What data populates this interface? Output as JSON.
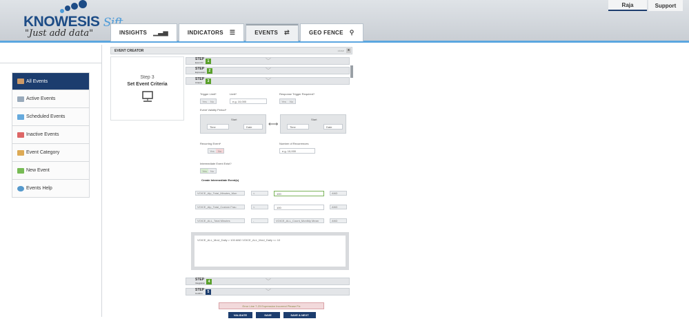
{
  "brand": {
    "name": "KNOWESIS",
    "sub": "Sift",
    "tagline": "\"Just add data\""
  },
  "topnav": {
    "user": "Raja",
    "support": "Support"
  },
  "tabs": [
    {
      "label": "INSIGHTS",
      "icon": "bar-chart-icon"
    },
    {
      "label": "INDICATORS",
      "icon": "list-icon"
    },
    {
      "label": "EVENTS",
      "icon": "repeat-icon"
    },
    {
      "label": "GEO FENCE",
      "icon": "map-pin-icon"
    }
  ],
  "sidebar": {
    "items": [
      {
        "label": "All Events"
      },
      {
        "label": "Active Events"
      },
      {
        "label": "Scheduled Events"
      },
      {
        "label": "Inactive Events"
      },
      {
        "label": "Event Category"
      },
      {
        "label": "New Event"
      },
      {
        "label": "Events Help"
      }
    ]
  },
  "panel": {
    "title": "EVENT CREATOR",
    "close": "close",
    "x": "x"
  },
  "stepcard": {
    "line1": "Step 3",
    "line2": "Set Event Criteria"
  },
  "steps": [
    {
      "label": "STEP",
      "sub": "Event ID",
      "num": "1",
      "color": "#5aa02c"
    },
    {
      "label": "STEP",
      "sub": "Expression",
      "num": "2",
      "color": "#5aa02c"
    },
    {
      "label": "STEP",
      "sub": "Criteria",
      "num": "3",
      "color": "#5aa02c"
    },
    {
      "label": "STEP",
      "sub": "Integration",
      "num": "4",
      "color": "#5aa02c"
    },
    {
      "label": "STEP",
      "sub": "Confirm",
      "num": "5",
      "color": "#1c3d6e"
    }
  ],
  "form": {
    "trigger_limit": "Trigger Limit*",
    "limit": "Limit*",
    "limit_ph": "e.g. 10,000",
    "response": "Response Trigger Required?",
    "yes": "Yes",
    "no": "No",
    "validity": "Event Validity Period*",
    "start": "Start",
    "end": "Start",
    "time": "Time",
    "date": "Date",
    "recurring": "Recurring Event*",
    "num_recur": "Number of Recurrences",
    "recur_ph": "e.g. 10,000",
    "intermediate": "Intermediate Event Exist?",
    "create_inter": "Create Intermediate Event(s)"
  },
  "expr_rows": [
    {
      "field": "VOICE_Alp_Total_Minutes_Mon",
      "op": "<",
      "val": "100",
      "join": "AND"
    },
    {
      "field": "VOICE_Alp_Total_Custom Frau",
      "op": "<",
      "val": "100",
      "join": "AND"
    },
    {
      "field": "VOICE_ALL_Total Minutes",
      "op": "-",
      "val": "VOICE_ALL_Count_Monthly Mean",
      "join": "AND"
    }
  ],
  "expression": "VOICE_ALL_MoU_Daily > 100 AND VOICE_ALL_MoU_Daily <= 10",
  "error": "Error Line 7-23 Expression Incorrect Please Fix",
  "buttons": {
    "validate": "VALIDATE",
    "save": "SAVE",
    "save_next": "SAVE & NEXT"
  }
}
